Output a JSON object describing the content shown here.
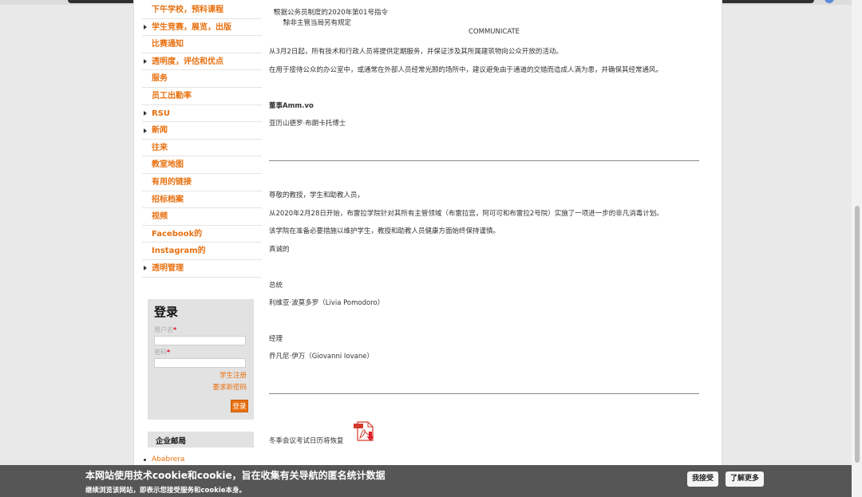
{
  "menu": [
    {
      "label": "下午学校，预科课程",
      "arrow": false
    },
    {
      "label": "学生竞赛，展览，出版",
      "arrow": true
    },
    {
      "label": "比赛通知",
      "arrow": false
    },
    {
      "label": "透明度，评估和优点",
      "arrow": true
    },
    {
      "label": "服务",
      "arrow": false
    },
    {
      "label": "员工出勤率",
      "arrow": false
    },
    {
      "label": "RSU",
      "arrow": true
    },
    {
      "label": "新闻",
      "arrow": true
    },
    {
      "label": "往来",
      "arrow": false
    },
    {
      "label": "教室地图",
      "arrow": false
    },
    {
      "label": "有用的链接",
      "arrow": false
    },
    {
      "label": "招标档案",
      "arrow": false
    },
    {
      "label": "视频",
      "arrow": false
    },
    {
      "label": "Facebook的",
      "arrow": false
    },
    {
      "label": "Instagram的",
      "arrow": false
    },
    {
      "label": "透明管理",
      "arrow": true
    }
  ],
  "login": {
    "title": "登录",
    "username_label": "用户名",
    "password_label": "密码",
    "required_mark": "*",
    "register_link": "学生注册",
    "new_password_link": "要求新密码",
    "submit_label": "登录"
  },
  "mailbox": {
    "title": "企业邮局",
    "item": "Ababrera"
  },
  "content": {
    "bullet1": "根据公务员制度的2020年第01号指令",
    "bullet2": "除非主管当局另有规定",
    "communicate": "COMMUNICATE",
    "p1": "从3月2日起，所有技术和行政人员将提供定期服务，并保证涉及其所属建筑物向公众开放的活动。",
    "p2": "在用于接待公众的办公室中，或通常在外部人员经常光顾的场所中，建议避免由于通道的交错而造成人满为患，并确保其经常通风。",
    "director_title": "董事Amm.vo",
    "director_name": "亚历山德罗·布朗卡托博士",
    "greeting": "尊敬的教授，学生和助教人员，",
    "p3": "从2020年2月28日开始，布雷拉学院针对其所有主管领域（布雷拉宫，阿可可和布雷拉2号院）实施了一项进一步的非凡消毒计划。",
    "p4": "该学院在准备必要措施以维护学生，教授和助教人员健康方面始终保持谨慎。",
    "sincerely": "真诚的",
    "president_title": "总统",
    "president_name": "利维亚·波莫多罗（Livia Pomodoro）",
    "manager_title": "经理",
    "manager_name": "乔凡尼·伊万（Giovanni Iovane）",
    "calendar_note": "冬季会议考试日历将恢复"
  },
  "cookie": {
    "message": "本网站使用技术cookie和cookie，旨在收集有关导航的匿名统计数据",
    "sub": "继续浏览该网站，即表示您接受服务和cookie本身。",
    "accept": "我接受",
    "more": "了解更多"
  },
  "colors": {
    "accent": "#e8700f",
    "cookie_bg": "#565656",
    "sidebar_box": "#e2e2e2"
  },
  "icons": {
    "pdf": "pdf-download-icon"
  }
}
